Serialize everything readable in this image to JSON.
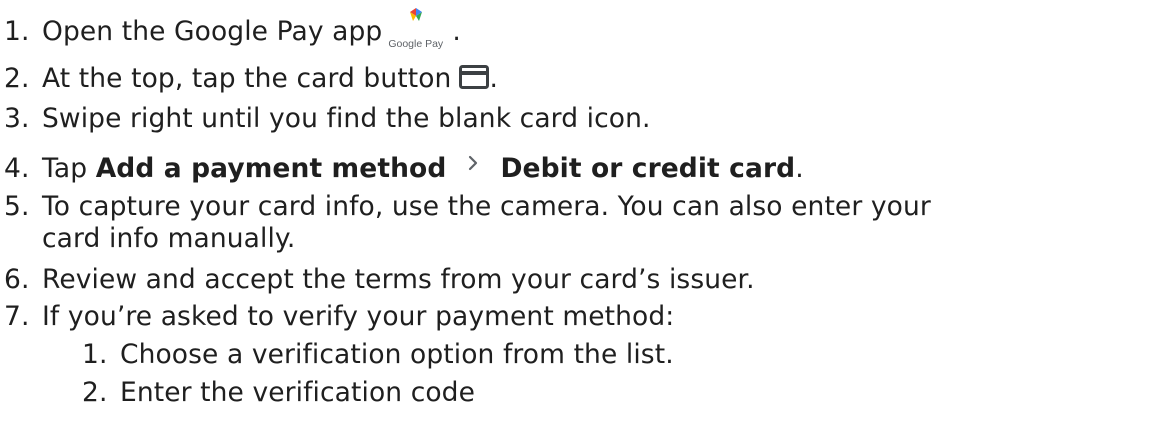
{
  "steps": [
    {
      "num": "1.",
      "text": "Open the Google Pay app",
      "after": "."
    },
    {
      "num": "2.",
      "text": "At the top, tap the card button",
      "after": "."
    },
    {
      "num": "3.",
      "text": "Swipe right until you find the blank card icon."
    },
    {
      "num": "4.",
      "pre": "Tap",
      "bold1": "Add a payment method",
      "bold2": "Debit or credit card",
      "after": "."
    },
    {
      "num": "5.",
      "line1": "To capture your card info, use the camera. You can also enter your",
      "line2": "card info manually."
    },
    {
      "num": "6.",
      "text": "Review and accept the terms from your card’s issuer."
    },
    {
      "num": "7.",
      "text": "If you’re asked to verify your payment method:"
    }
  ],
  "substeps": [
    {
      "num": "1.",
      "text": "Choose a verification option from the list."
    },
    {
      "num": "2.",
      "text": "Enter the verification code"
    }
  ],
  "logo": {
    "wordmark": "Google Pay"
  },
  "icons": {
    "google_pay_logo": "google-pay-logo-icon",
    "card_button": "credit-card-icon",
    "chevron": "chevron-right-icon"
  },
  "colors": {
    "text": "#1f1f1f",
    "icon": "#3c4043",
    "chevron": "#5f6368"
  }
}
